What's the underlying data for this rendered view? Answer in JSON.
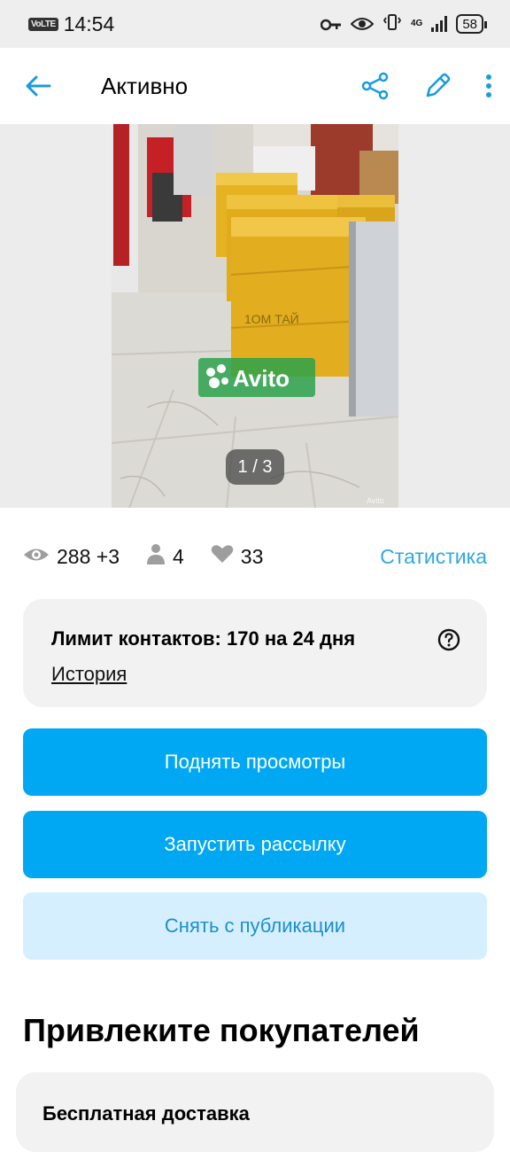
{
  "status_bar": {
    "network_badge": "VoLTE",
    "time": "14:54",
    "network_type": "4G",
    "battery": "58"
  },
  "app_bar": {
    "title": "Активно"
  },
  "gallery": {
    "watermark": "Avito",
    "counter": "1 / 3",
    "box_label": "1ОМ ТАЙ",
    "corner_mark": "Avito"
  },
  "stats": {
    "views": "288 +3",
    "contacts": "4",
    "favorites": "33",
    "statistics_link": "Статистика"
  },
  "limit_card": {
    "title": "Лимит контактов: 170 на 24 дня",
    "history_link": "История"
  },
  "buttons": {
    "raise_views": "Поднять просмотры",
    "start_mailing": "Запустить рассылку",
    "unpublish": "Снять с публикации"
  },
  "promo": {
    "section_title": "Привлеките покупателей",
    "free_delivery": "Бесплатная доставка"
  },
  "colors": {
    "accent": "#00a8f3",
    "link": "#2fa8e0",
    "secondary_button_bg": "#d6efff",
    "secondary_button_text": "#1a8fcf",
    "card_bg": "#f2f2f2"
  }
}
